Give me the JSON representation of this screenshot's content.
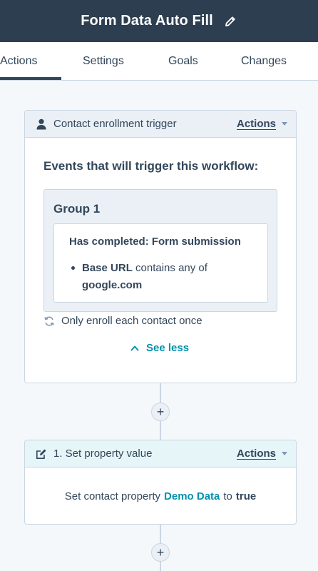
{
  "header": {
    "title": "Form Data Auto Fill",
    "edit_icon": "pencil-icon"
  },
  "tabs": [
    {
      "label": "Actions",
      "active": true
    },
    {
      "label": "Settings",
      "active": false
    },
    {
      "label": "Goals",
      "active": false
    },
    {
      "label": "Changes",
      "active": false
    }
  ],
  "trigger_card": {
    "icon": "person-icon",
    "title": "Contact enrollment trigger",
    "actions_label": "Actions",
    "events_heading": "Events that will trigger this workflow:",
    "group": {
      "label": "Group 1",
      "condition_title": "Has completed: Form submission",
      "filter_property": "Base URL",
      "filter_operator": "contains any of",
      "filter_value": "google.com"
    },
    "enroll_icon": "refresh-icon",
    "enroll_text": "Only enroll each contact once",
    "see_less_label": "See less"
  },
  "connectors": {
    "add_label": "+"
  },
  "action_card": {
    "icon": "edit-icon",
    "title": "1. Set property value",
    "actions_label": "Actions",
    "body_prefix": "Set contact property",
    "property": "Demo Data",
    "connector_word": "to",
    "value": "true"
  },
  "colors": {
    "header_bg": "#2d3e50",
    "accent_teal": "#0091ae",
    "text": "#33475b",
    "border": "#cbd6e2",
    "trigger_header_bg": "#eaf0f6",
    "action_header_bg": "#e5f5f8"
  }
}
